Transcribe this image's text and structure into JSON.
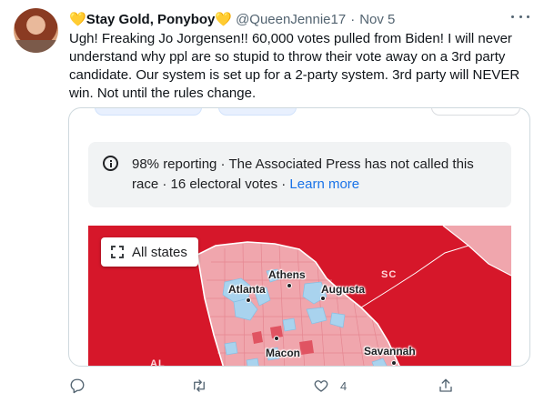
{
  "tweet": {
    "display_name": "Stay Gold, Ponyboy",
    "name_emoji": "💛",
    "handle": "@QueenJennie17",
    "separator": "·",
    "date": "Nov 5",
    "text": "Ugh! Freaking Jo Jorgensen!! 60,000 votes pulled from Biden! I will never understand why ppl are so stupid to throw their vote away on a 3rd party candidate. Our system is set up for a 2-party system. 3rd party will NEVER win. Not until the rules change."
  },
  "media": {
    "notice_main": "98% reporting · The Associated Press has not called this race · 16 electoral votes · ",
    "notice_link": "Learn more",
    "all_states_label": "All states",
    "map_labels": {
      "sc": "SC",
      "al": "AL",
      "athens": "Athens",
      "atlanta": "Atlanta",
      "augusta": "Augusta",
      "macon": "Macon",
      "savannah": "Savannah"
    },
    "colors": {
      "republican": "#d6172a",
      "republican_light": "#f0a6ad",
      "democrat_light": "#a9d3ee"
    }
  },
  "actions": {
    "reply_count": "",
    "retweet_count": "",
    "like_count": "4",
    "icons": [
      "reply-icon",
      "retweet-icon",
      "like-icon",
      "share-icon"
    ]
  }
}
